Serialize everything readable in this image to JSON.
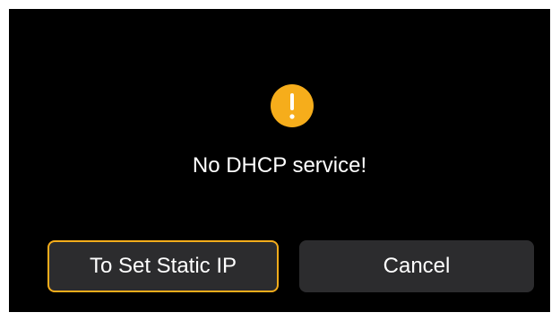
{
  "dialog": {
    "icon": "warning-exclamation-icon",
    "message": "No DHCP service!",
    "buttons": {
      "static_ip_label": "To Set Static IP",
      "cancel_label": "Cancel"
    }
  },
  "colors": {
    "background": "#000000",
    "accent": "#f6ad1b",
    "button_bg": "#2c2c2e",
    "text": "#ffffff"
  }
}
